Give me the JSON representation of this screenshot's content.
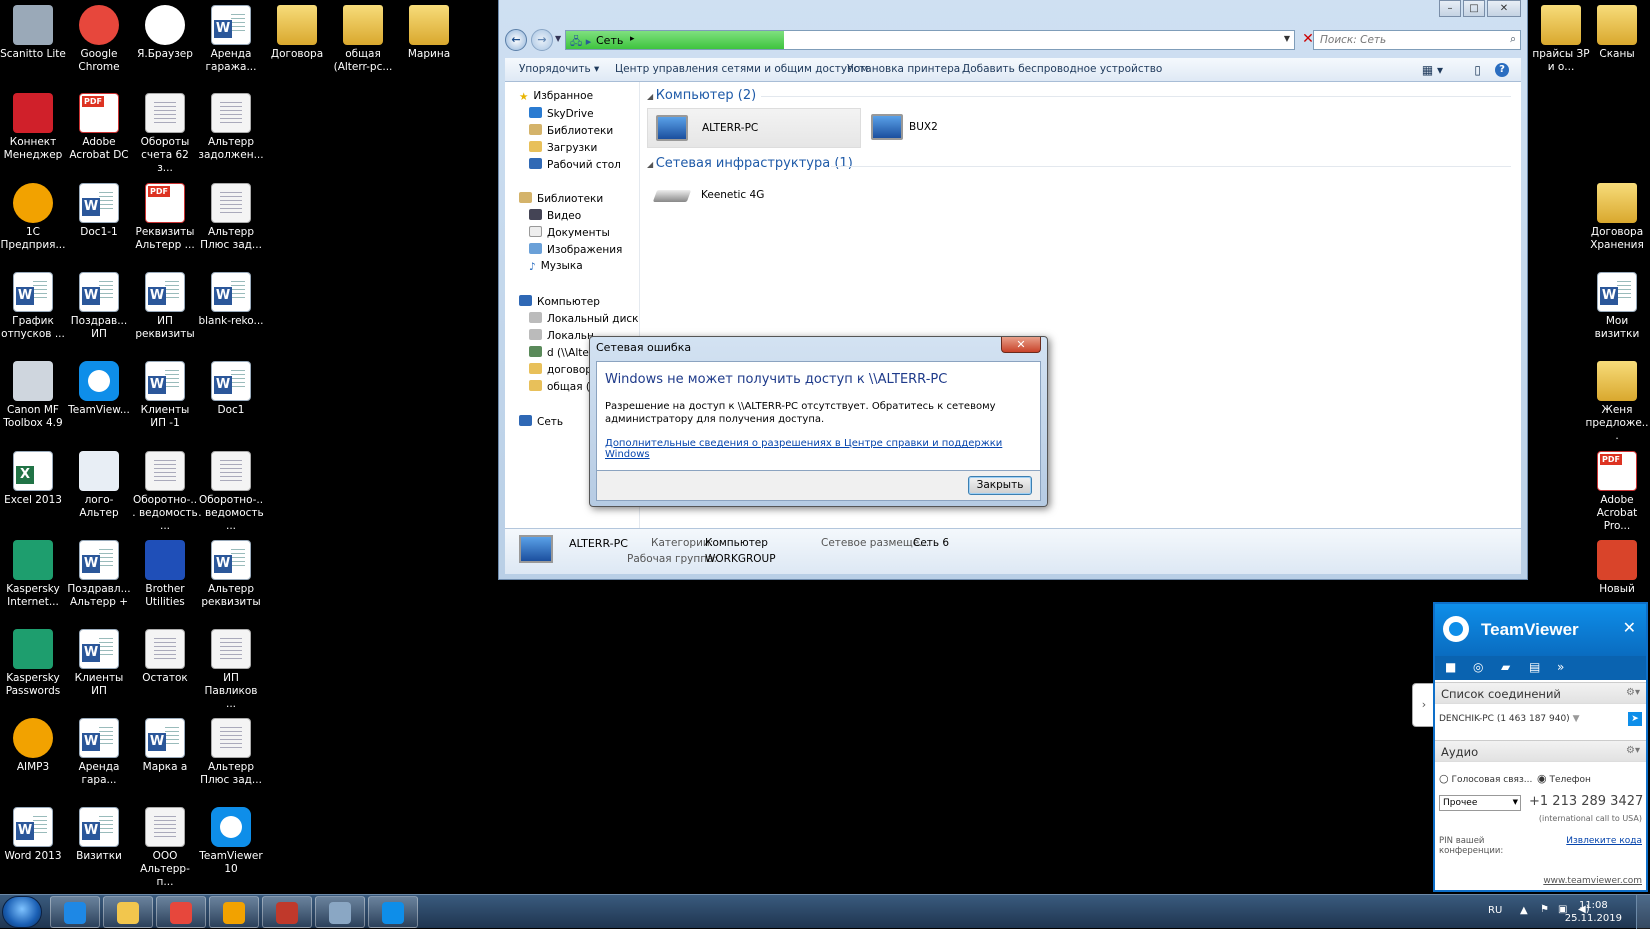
{
  "desktop": {
    "icons": [
      {
        "id": "scanitto",
        "label": "Scanitto Lite",
        "kind": "app",
        "color": "#9aa9b8"
      },
      {
        "id": "chrome",
        "label": "Google Chrome",
        "kind": "round",
        "color": "#e7473c"
      },
      {
        "id": "yabrowser",
        "label": "Я.Браузер",
        "kind": "round",
        "color": "#ffffff"
      },
      {
        "id": "arenda-garazha",
        "label": "Аренда гаража...",
        "kind": "word"
      },
      {
        "id": "dogovora",
        "label": "Договора",
        "kind": "folder"
      },
      {
        "id": "obshaya",
        "label": "общая (Alterr-pc...",
        "kind": "folder"
      },
      {
        "id": "marina",
        "label": "Марина",
        "kind": "folder"
      },
      {
        "id": "konnekt",
        "label": "Коннект Менеджер",
        "kind": "app",
        "color": "#d0202a"
      },
      {
        "id": "acrobat",
        "label": "Adobe Acrobat DC",
        "kind": "pdf"
      },
      {
        "id": "oboroty",
        "label": "Обороты счета 62 з...",
        "kind": "doc"
      },
      {
        "id": "alterr-zadolzh",
        "label": "Альтерр задолжен...",
        "kind": "doc"
      },
      {
        "id": "1c",
        "label": "1С Предприя...",
        "kind": "round",
        "color": "#f2a200"
      },
      {
        "id": "doc1-1",
        "label": "Doc1-1",
        "kind": "word"
      },
      {
        "id": "rekvizity-alterr",
        "label": "Реквизиты Альтерр ...",
        "kind": "pdf"
      },
      {
        "id": "alterr-plus",
        "label": "Альтерр Плюс зад...",
        "kind": "doc"
      },
      {
        "id": "grafik",
        "label": "График отпусков ...",
        "kind": "word"
      },
      {
        "id": "pozdrav-ip",
        "label": "Поздрав... ИП",
        "kind": "word"
      },
      {
        "id": "ip-rekvizity",
        "label": "ИП реквизиты",
        "kind": "word"
      },
      {
        "id": "blank-reko",
        "label": "blank-reko...",
        "kind": "word"
      },
      {
        "id": "canon",
        "label": "Canon MF Toolbox 4.9",
        "kind": "app",
        "color": "#cfd6de"
      },
      {
        "id": "teamviewer-link",
        "label": "TeamView...",
        "kind": "tv"
      },
      {
        "id": "klienty-ip-1",
        "label": "Клиенты ИП -1",
        "kind": "word"
      },
      {
        "id": "doc1",
        "label": "Doc1",
        "kind": "word"
      },
      {
        "id": "excel",
        "label": "Excel 2013",
        "kind": "xls"
      },
      {
        "id": "logo-alterr",
        "label": "лого-Альтер",
        "kind": "app",
        "color": "#e8eef5"
      },
      {
        "id": "oborotno1",
        "label": "Оборотно-... ведомость ...",
        "kind": "doc"
      },
      {
        "id": "oborotno2",
        "label": "Оборотно-... ведомость ...",
        "kind": "doc"
      },
      {
        "id": "kaspersky-is",
        "label": "Kaspersky Internet...",
        "kind": "app",
        "color": "#1e9e6e"
      },
      {
        "id": "pozdrav-alterr",
        "label": "Поздравл... Альтерр +",
        "kind": "word"
      },
      {
        "id": "brother",
        "label": "Brother Utilities",
        "kind": "app",
        "color": "#1f4fb8"
      },
      {
        "id": "alterr-rekv",
        "label": "Альтерр реквизиты",
        "kind": "word"
      },
      {
        "id": "kaspersky-pw",
        "label": "Kaspersky Passwords",
        "kind": "app",
        "color": "#1e9e6e"
      },
      {
        "id": "klienty-ip",
        "label": "Клиенты ИП",
        "kind": "word"
      },
      {
        "id": "ostatok",
        "label": "Остаток",
        "kind": "doc"
      },
      {
        "id": "ip-pavlikov",
        "label": "ИП Павликов ...",
        "kind": "doc"
      },
      {
        "id": "aimp",
        "label": "AIMP3",
        "kind": "round",
        "color": "#f2a200"
      },
      {
        "id": "arenda-gara2",
        "label": "Аренда гара...",
        "kind": "word"
      },
      {
        "id": "marka",
        "label": "Марка а",
        "kind": "word"
      },
      {
        "id": "alterr-plus2",
        "label": "Альтерр Плюс зад...",
        "kind": "doc"
      },
      {
        "id": "word2013",
        "label": "Word 2013",
        "kind": "word"
      },
      {
        "id": "vizitki",
        "label": "Визитки",
        "kind": "word"
      },
      {
        "id": "ooo-alterr",
        "label": "ООО Альтерр-п...",
        "kind": "doc"
      },
      {
        "id": "teamviewer10",
        "label": "TeamViewer 10",
        "kind": "tv"
      }
    ],
    "right_icons": [
      {
        "id": "praisy",
        "label": "прайсы ЗР и о...",
        "kind": "folder"
      },
      {
        "id": "skany",
        "label": "Сканы",
        "kind": "folder"
      },
      {
        "id": "dogovora-hran",
        "label": "Договора Хранения",
        "kind": "folder"
      },
      {
        "id": "moi-vizitki",
        "label": "Мои визитки",
        "kind": "word"
      },
      {
        "id": "zhenya",
        "label": "Женя предложе...",
        "kind": "folder"
      },
      {
        "id": "adobe-acrobat-pro",
        "label": "Adobe Acrobat Pro...",
        "kind": "pdf"
      },
      {
        "id": "novyi",
        "label": "Новый",
        "kind": "app",
        "color": "#d9442a"
      }
    ]
  },
  "explorer": {
    "address": "Сеть",
    "search_placeholder": "Поиск: Сеть",
    "address_progress_percent": 30,
    "toolbar": {
      "organize": "Упорядочить",
      "network_center": "Центр управления сетями и общим доступом",
      "install_printer": "Установка принтера",
      "add_wireless": "Добавить беспроводное устройство"
    },
    "nav": {
      "favorites": "Избранное",
      "skydrive": "SkyDrive",
      "libraries_fav": "Библиотеки",
      "downloads": "Загрузки",
      "desktop": "Рабочий стол",
      "libraries": "Библиотеки",
      "video": "Видео",
      "documents": "Документы",
      "images": "Изображения",
      "music": "Музыка",
      "computer": "Компьютер",
      "local_disk_c": "Локальный диск (C",
      "local_disk": "Локальн",
      "d_alterr": "d (\\\\Alte",
      "dogovora": "договора",
      "obshaya": "общая (А",
      "network": "Сеть"
    },
    "groups": {
      "computers": "Компьютер (2)",
      "infrastructure": "Сетевая инфраструктура (1)"
    },
    "items": {
      "pc1": "ALTERR-PC",
      "pc2": "BUX2",
      "router": "Keenetic 4G"
    },
    "details": {
      "name": "ALTERR-PC",
      "categories_label": "Категории:",
      "categories_value": "Компьютер",
      "workgroup_label": "Рабочая группа:",
      "workgroup_value": "WORKGROUP",
      "location_label": "Сетевое размеще...",
      "location_value": "Сеть 6"
    }
  },
  "dialog": {
    "title": "Сетевая ошибка",
    "heading": "Windows не может получить доступ к \\\\ALTERR-PC",
    "message": "Разрешение на доступ к \\\\ALTERR-PC отсутствует. Обратитесь к сетевому администратору для получения доступа.",
    "link": "Дополнительные сведения о разрешениях в Центре справки и поддержки Windows",
    "close_button": "Закрыть"
  },
  "teamviewer": {
    "title": "TeamViewer",
    "connections_header": "Список соединений",
    "connection_entry": "DENCHIK-PC (1 463 187 940)",
    "audio_header": "Аудио",
    "voice_option": "Голосовая связ...",
    "phone_option": "Телефон",
    "selected_audio": "Телефон",
    "dropdown_value": "Прочее",
    "phone_number": "+1 213 289 3427",
    "phone_note": "(international call to USA)",
    "pin_label": "PIN вашей конференции:",
    "pin_link": "Извлеките кода",
    "website": "www.teamviewer.com"
  },
  "taskbar": {
    "lang": "RU",
    "time": "11:08",
    "date": "25.11.2019",
    "apps": [
      {
        "name": "ie",
        "color": "#1e88e5"
      },
      {
        "name": "explorer",
        "color": "#f2c64d"
      },
      {
        "name": "chrome",
        "color": "#e7473c"
      },
      {
        "name": "1c",
        "color": "#f2a200"
      },
      {
        "name": "cc4",
        "color": "#c0392b"
      },
      {
        "name": "calc",
        "color": "#8aa7c4"
      },
      {
        "name": "teamviewer",
        "color": "#0e8ee9"
      }
    ]
  }
}
